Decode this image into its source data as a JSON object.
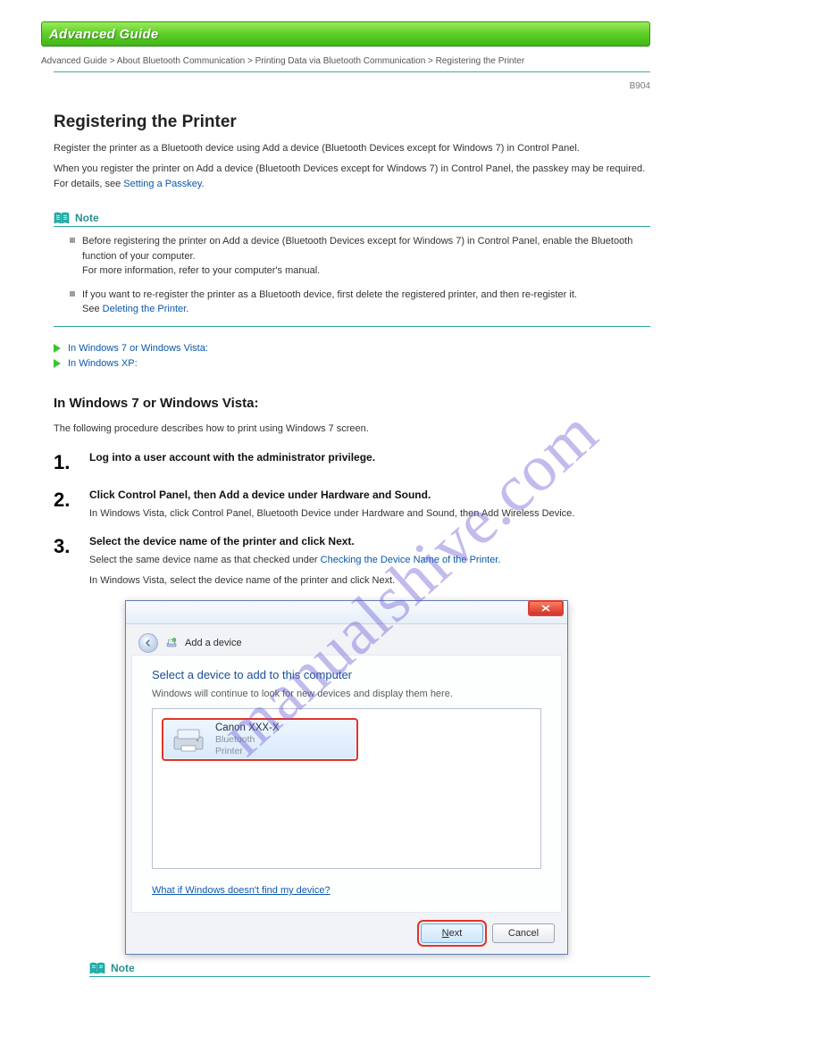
{
  "banner": {
    "title": "Advanced Guide"
  },
  "breadcrumb": "Advanced Guide > About Bluetooth Communication > Printing Data via Bluetooth Communication > Registering the Printer",
  "code": "B904",
  "h1": "Registering the Printer",
  "intro1": "Register the printer as a Bluetooth device using Add a device (Bluetooth Devices except for Windows 7) in Control Panel.",
  "intro2": "When you register the printer on Add a device (Bluetooth Devices except for Windows 7) in Control Panel, the passkey may be required. For details, see ",
  "setting_link_text": "Setting a Passkey",
  "note_label": "Note",
  "note1": "Before registering the printer on Add a device (Bluetooth Devices except for Windows 7) in Control Panel, enable the Bluetooth function of your computer.\nFor more information, refer to your computer's manual.",
  "note2": "If you want to re-register the printer as a Bluetooth device, first delete the registered printer, and then re-register it.\nSee ",
  "deleting_link_text": "Deleting the Printer",
  "link_win7": "In Windows 7 or Windows Vista:",
  "link_winxp": "In Windows XP:",
  "section_anchor": "In Windows 7 or Windows Vista:",
  "section_lead": "The following procedure describes how to print using Windows 7 screen.",
  "steps": [
    {
      "n": "1.",
      "title": "Log into a user account with the administrator privilege.",
      "text": "",
      "text2": ""
    },
    {
      "n": "2.",
      "title": "Click Control Panel, then Add a device under Hardware and Sound.",
      "text": "In Windows Vista, click Control Panel, Bluetooth Device under Hardware and Sound, then Add Wireless Device.",
      "text2": ""
    },
    {
      "n": "3.",
      "title": "Select the device name of the printer and click Next.",
      "devhint": [
        "Select the same device name as that checked under ",
        "Checking the Device Name of the Printer"
      ],
      "vista_note": "In Windows Vista, select the device name of the printer and click Next."
    }
  ],
  "devwin": {
    "nav": "Add a device",
    "headline": "Select a device to add to this computer",
    "subline": "Windows will continue to look for new devices and display them here.",
    "device": {
      "name": "Canon  XXX-X",
      "line2": "Bluetooth",
      "line3": "Printer"
    },
    "help": "What if Windows doesn't find my device?",
    "next": "Next",
    "cancel": "Cancel"
  },
  "bottom_note_label": "Note",
  "watermark": "manualshive.com"
}
